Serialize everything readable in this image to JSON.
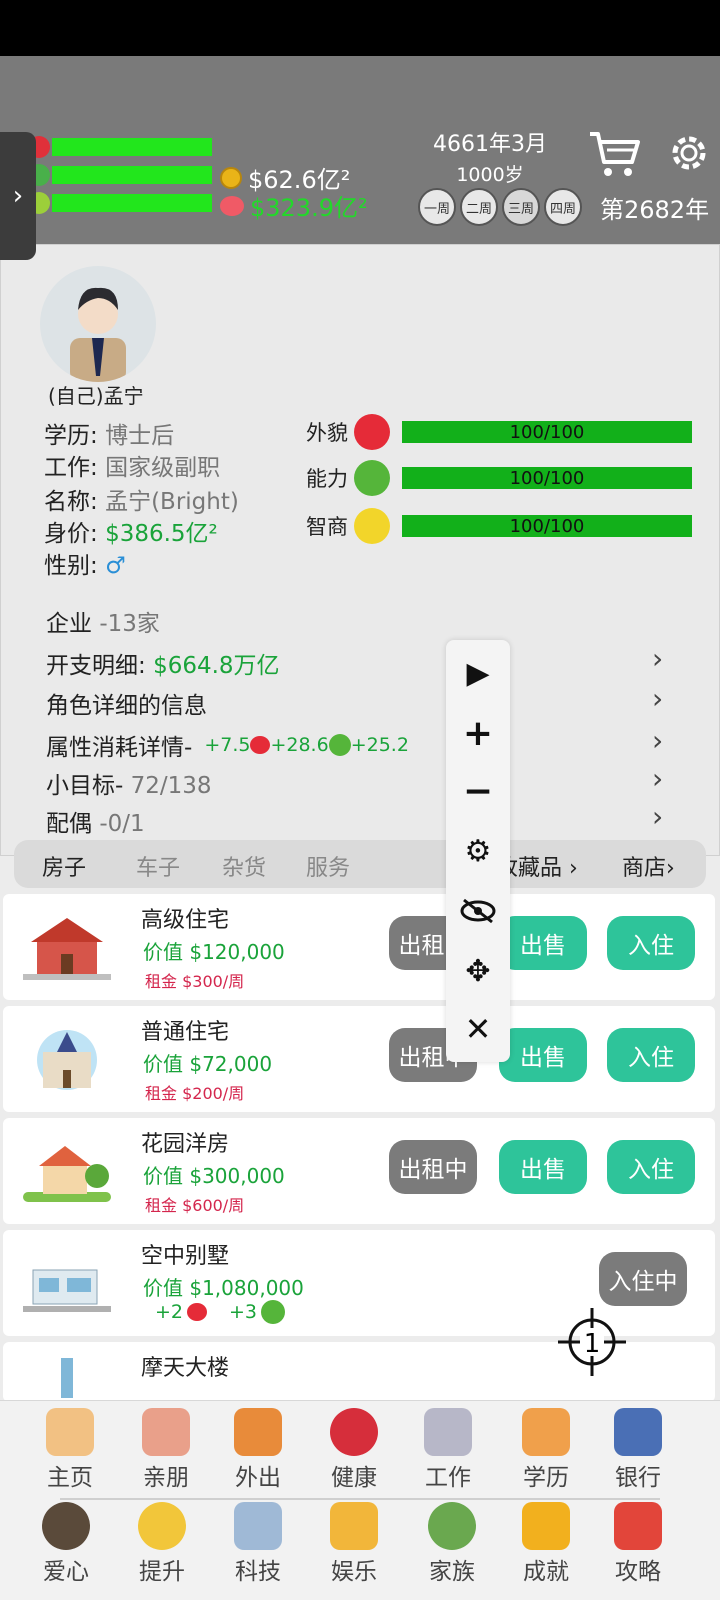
{
  "header": {
    "money": "$62.6亿²",
    "savings": "$323.9亿²",
    "date": "4661年3月",
    "age": "1000岁",
    "weeks": [
      "一周",
      "二周",
      "三周",
      "四周"
    ],
    "year": "第2682年"
  },
  "profile": {
    "caption": "(自己)孟宁",
    "education_label": "学历:",
    "education": "博士后",
    "job_label": "工作:",
    "job": "国家级副职",
    "name_label": "名称:",
    "name": "孟宁(Bright)",
    "worth_label": "身价:",
    "worth": "$386.5亿²",
    "gender_label": "性别:",
    "gender": "♂"
  },
  "attributes": [
    {
      "label": "外貌",
      "value": "100/100"
    },
    {
      "label": "能力",
      "value": "100/100"
    },
    {
      "label": "智商",
      "value": "100/100"
    }
  ],
  "details": {
    "company_label": "企业",
    "company": "-13家",
    "expense_label": "开支明细:",
    "expense": "$664.8万亿",
    "role_info": "角色详细的信息",
    "consume_label": "属性消耗详情-",
    "consume_a": "+7.5",
    "consume_b": "+28.6",
    "consume_c": "+25.2",
    "goal_label": "小目标-",
    "goal": "72/138",
    "spouse_label": "配偶",
    "spouse": "-0/1"
  },
  "tabs": [
    "房子",
    "车子",
    "杂货",
    "服务",
    "收藏品",
    "商店"
  ],
  "properties": [
    {
      "title": "高级住宅",
      "price": "价值 $120,000",
      "rent": "租金 $300/周",
      "b1": "出租中",
      "b2": "出售",
      "b3": "入住"
    },
    {
      "title": "普通住宅",
      "price": "价值 $72,000",
      "rent": "租金 $200/周",
      "b1": "出租中",
      "b2": "出售",
      "b3": "入住"
    },
    {
      "title": "花园洋房",
      "price": "价值 $300,000",
      "rent": "租金 $600/周",
      "b1": "出租中",
      "b2": "出售",
      "b3": "入住"
    },
    {
      "title": "空中别墅",
      "price": "价值 $1,080,000",
      "bonus_a": "+2",
      "bonus_b": "+3",
      "b3": "入住中"
    },
    {
      "title": "摩天大楼"
    }
  ],
  "crosshair_num": "1",
  "nav": [
    "主页",
    "亲朋",
    "外出",
    "健康",
    "工作",
    "学历",
    "银行",
    "爱心",
    "提升",
    "科技",
    "娱乐",
    "家族",
    "成就",
    "攻略"
  ]
}
